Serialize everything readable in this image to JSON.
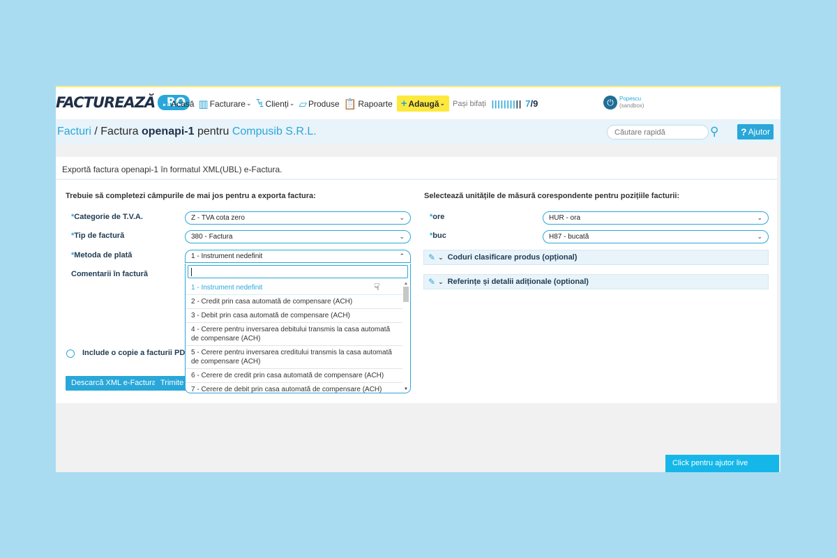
{
  "nav": {
    "logo_text": "FACTUREAZĂ",
    "logo_badge": ".RO",
    "items": [
      {
        "label": "Acasă",
        "icon": "home-icon",
        "glyph": "⌂",
        "dropdown": false
      },
      {
        "label": "Facturare",
        "icon": "invoices-icon",
        "glyph": "▥",
        "dropdown": true
      },
      {
        "label": "Clienți",
        "icon": "clients-icon",
        "glyph": "ꔃ",
        "dropdown": true
      },
      {
        "label": "Produse",
        "icon": "products-icon",
        "glyph": "▱",
        "dropdown": false
      },
      {
        "label": "Rapoarte",
        "icon": "reports-icon",
        "glyph": "📋",
        "dropdown": false
      }
    ],
    "add_label": "Adaugă",
    "steps_label": "Pași bifați",
    "steps_done": "7",
    "steps_total": "/9",
    "user_name": "Popescu",
    "user_env": "(sandbox)"
  },
  "breadcrumb": {
    "root": "Facturi",
    "separator": "/",
    "prefix": "Factura",
    "invoice": "openapi-1",
    "middle": "pentru",
    "client": "Compusib S.R.L."
  },
  "search": {
    "placeholder": "Căutare rapidă"
  },
  "help_label": "Ajutor",
  "panel": {
    "title": "Exportă factura openapi-1 în formatul XML(UBL) e-Factura.",
    "left_heading": "Trebuie să completezi câmpurile de mai jos pentru a exporta factura:",
    "right_heading": "Selectează unitățile de măsură corespondente pentru pozițiile facturii:",
    "fields": {
      "vat_label": "Categorie de T.V.A.",
      "vat_value": "Z - TVA cota zero",
      "type_label": "Tip de factură",
      "type_value": "380 - Factura",
      "payment_label": "Metoda de plată",
      "payment_value": "1 - Instrument nedefinit",
      "comments_label": "Comentarii în factură"
    },
    "units": {
      "ore_label": "ore",
      "ore_value": "HUR - ora",
      "buc_label": "buc",
      "buc_value": "H87 - bucată"
    },
    "collapse1": "Coduri clasificare produs (opțional)",
    "collapse2": "Referințe și detalii adiționale (optional)",
    "pdf_checkbox": "Include o copie a facturii PDF în f",
    "download_btn": "Descarcă XML e-Factura",
    "send_btn": "Trimite"
  },
  "dropdown": {
    "search_value": "",
    "options": [
      "1 - Instrument nedefinit",
      "2 - Credit prin casa automată de compensare (ACH)",
      "3 - Debit prin casa automată de compensare (ACH)",
      "4 - Cerere pentru inversarea debitului transmis la casa automată de compensare (ACH)",
      "5 - Cerere pentru inversarea creditului transmis la casa automată de compensare (ACH)",
      "6 - Cerere de credit prin casa automată de compensare (ACH)",
      "7 - Cerere de debit prin casa automată de compensare (ACH)"
    ]
  },
  "live_help": "Click pentru ajutor live",
  "colors": {
    "accent": "#29a7d9",
    "highlight": "#fde93e",
    "background": "#aadcf1"
  }
}
